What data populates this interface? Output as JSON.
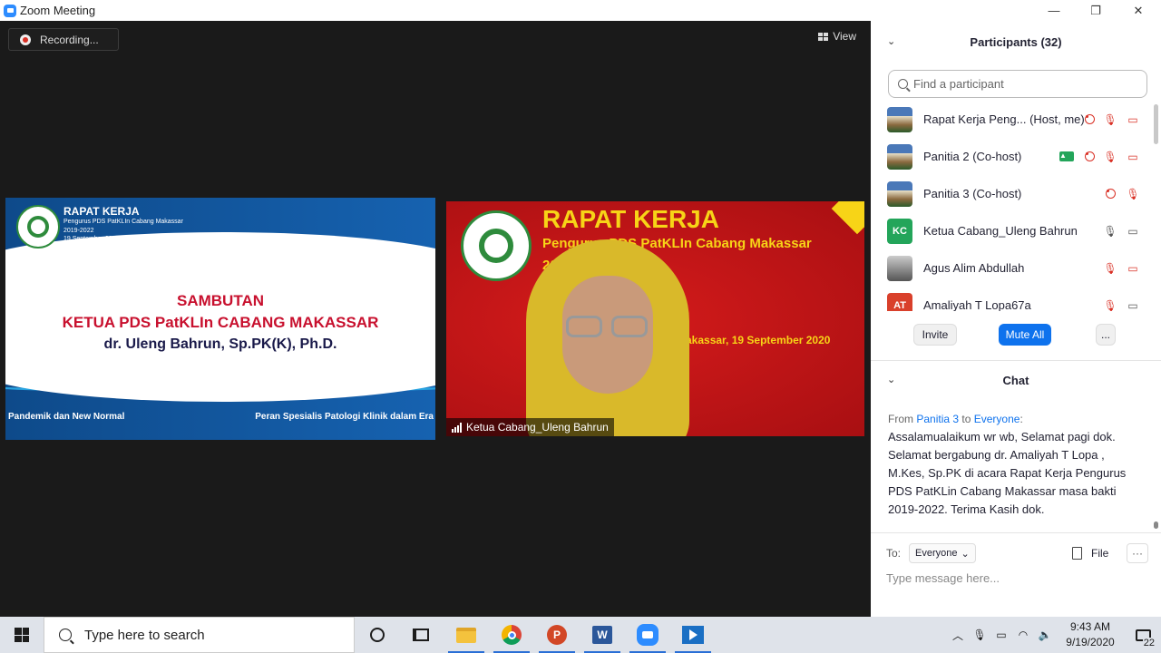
{
  "window": {
    "title": "Zoom Meeting",
    "minimize_glyph": "—",
    "restore_glyph": "❐",
    "close_glyph": "✕"
  },
  "stage": {
    "recording_label": "Recording...",
    "view_label": "View"
  },
  "tile_slide": {
    "header_title": "RAPAT KERJA",
    "header_sub": "Pengurus PDS PatKLIn Cabang Makassar",
    "header_years": "2019-2022",
    "header_date": "19 September 2020",
    "line1": "SAMBUTAN",
    "line2": "KETUA PDS PatKLIn CABANG MAKASSAR",
    "line3": "dr. Uleng Bahrun, Sp.PK(K), Ph.D.",
    "footer_left": "Pandemik dan New Normal",
    "footer_right": "Peran Spesialis Patologi Klinik dalam Era"
  },
  "tile_video": {
    "banner_title": "RAPAT KERJA",
    "banner_sub": "Pengurus PDS PatKLIn Cabang Makassar",
    "banner_years": "20",
    "banner_date": "akassar, 19 September 2020",
    "participant_name": "Ketua Cabang_Uleng Bahrun"
  },
  "participants": {
    "header": "Participants (32)",
    "search_placeholder": "Find a participant",
    "list": [
      {
        "name": "Rapat Kerja Peng...  (Host, me)",
        "avatar": "photo",
        "recording": true,
        "mic": "off",
        "cam": "off"
      },
      {
        "name": "Panitia 2 (Co-host)",
        "avatar": "photo",
        "sharing": true,
        "recording": true,
        "mic": "off",
        "cam": "off"
      },
      {
        "name": "Panitia 3 (Co-host)",
        "avatar": "photo",
        "recording": true,
        "mic": "off"
      },
      {
        "name": "Ketua Cabang_Uleng Bahrun",
        "avatar": "KC",
        "mic": "on",
        "cam": "on"
      },
      {
        "name": "Agus Alim Abdullah",
        "avatar": "person",
        "mic": "off",
        "cam": "off"
      },
      {
        "name": "Amaliyah T Lopa67a",
        "avatar": "AT",
        "mic": "off",
        "cam": "on"
      }
    ],
    "invite_label": "Invite",
    "mute_all_label": "Mute All",
    "more_label": "..."
  },
  "chat": {
    "header": "Chat",
    "message": {
      "from_prefix": "From",
      "sender": "Panitia 3",
      "to_word": "to",
      "recipient": "Everyone",
      "colon": ":",
      "text": "Assalamualaikum wr wb, Selamat pagi dok. Selamat bergabung dr. Amaliyah T Lopa , M.Kes, Sp.PK di acara Rapat Kerja Pengurus PDS PatKLin Cabang Makassar masa bakti 2019-2022. Terima Kasih dok."
    },
    "to_label": "To:",
    "to_value": "Everyone",
    "file_label": "File",
    "more_label": "···",
    "input_placeholder": "Type message here..."
  },
  "taskbar": {
    "search_placeholder": "Type here to search",
    "ppt_letter": "P",
    "word_letter": "W",
    "time": "9:43 AM",
    "date": "9/19/2020",
    "notification_count": "22",
    "accent": "#2a6fd6"
  },
  "colors": {
    "zoom_blue": "#0e72ed",
    "muted_red": "#d93025",
    "kc_green": "#23a55a",
    "at_red": "#d9402b"
  }
}
